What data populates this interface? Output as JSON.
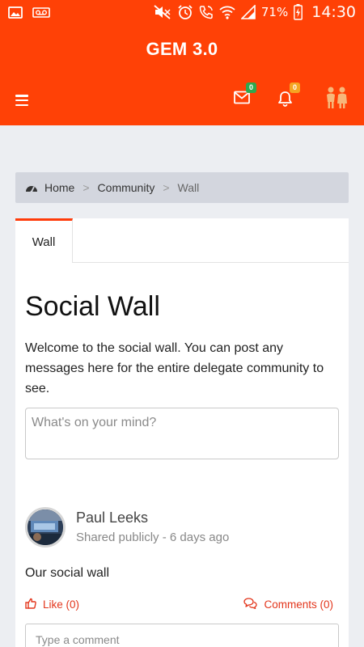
{
  "status_bar": {
    "battery_percent": "71%",
    "time": "14:30",
    "icons": [
      "image-icon",
      "voicemail-icon",
      "mute-icon",
      "alarm-icon",
      "wifi-call-icon",
      "wifi-icon",
      "signal-icon",
      "battery-charging-icon"
    ]
  },
  "header": {
    "title": "GEM 3.0",
    "mail_badge": "0",
    "notification_badge": "0",
    "colors": {
      "background": "#ff4106",
      "mail_badge": "#2fa84f",
      "notification_badge": "#f5a623"
    }
  },
  "breadcrumb": {
    "items": [
      "Home",
      "Community",
      "Wall"
    ],
    "separator": ">"
  },
  "tabs": [
    {
      "label": "Wall",
      "active": true
    }
  ],
  "page": {
    "title": "Social Wall",
    "intro": "Welcome to the social wall. You can post any messages here for the entire delegate community to see.",
    "post_placeholder": "What's on your mind?"
  },
  "post": {
    "author": "Paul Leeks",
    "meta": "Shared publicly - 6 days ago",
    "text": "Our social wall",
    "like_label": "Like (0)",
    "comments_label": "Comments (0)",
    "comment_placeholder": "Type a comment"
  }
}
